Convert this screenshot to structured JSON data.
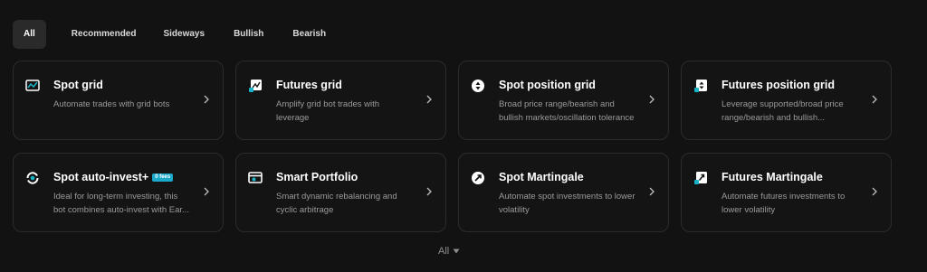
{
  "tabs": [
    {
      "label": "All",
      "active": true
    },
    {
      "label": "Recommended"
    },
    {
      "label": "Sideways"
    },
    {
      "label": "Bullish"
    },
    {
      "label": "Bearish"
    }
  ],
  "cards": [
    {
      "icon": "grid-chart-icon",
      "title": "Spot grid",
      "desc": "Automate trades with grid bots"
    },
    {
      "icon": "futures-grid-icon",
      "title": "Futures grid",
      "desc": "Amplify grid bot trades with leverage"
    },
    {
      "icon": "position-grid-icon",
      "title": "Spot position grid",
      "desc": "Broad price range/bearish and bullish markets/oscillation tolerance"
    },
    {
      "icon": "futures-position-icon",
      "title": "Futures position grid",
      "desc": "Leverage supported/broad price range/bearish and bullish..."
    },
    {
      "icon": "auto-invest-icon",
      "title": "Spot auto-invest+",
      "badge": "0 fees",
      "desc": "Ideal for long-term investing, this bot combines auto-invest with Ear..."
    },
    {
      "icon": "portfolio-icon",
      "title": "Smart Portfolio",
      "desc": "Smart dynamic rebalancing and cyclic arbitrage"
    },
    {
      "icon": "martingale-icon",
      "title": "Spot Martingale",
      "desc": "Automate spot investments to lower volatility"
    },
    {
      "icon": "futures-martingale-icon",
      "title": "Futures Martingale",
      "desc": "Automate futures investments to lower volatility"
    }
  ],
  "footer": {
    "label": "All",
    "icon": "caret-down-icon"
  },
  "colors": {
    "background": "#121212",
    "card_border": "#2c2c2c",
    "badge": "#1ba9c9",
    "accent_icon": "#19b3c7"
  }
}
